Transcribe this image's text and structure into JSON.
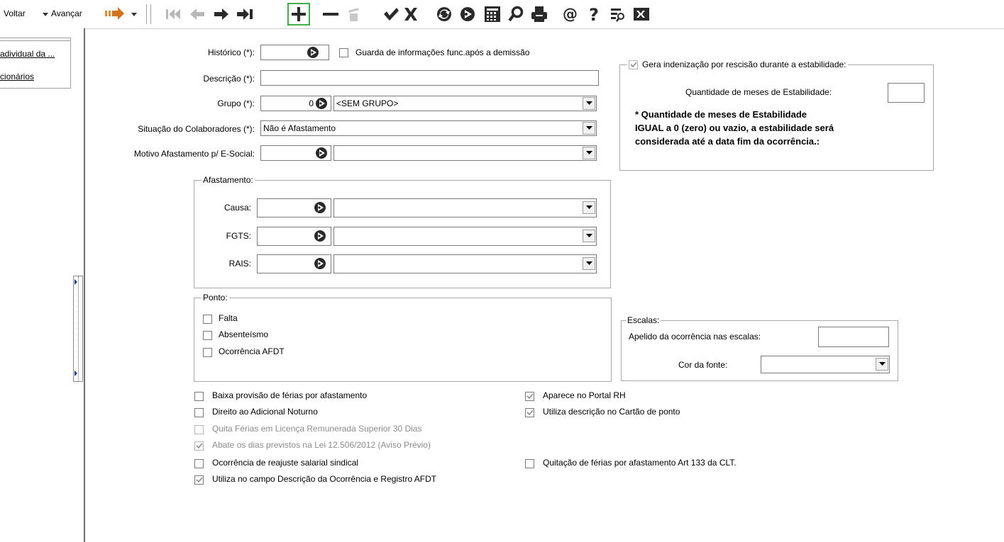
{
  "toolbar": {
    "back_label": "Voltar",
    "forward_label": "Avançar",
    "buttons": [
      "first-record-icon",
      "previous-record-icon",
      "next-record-icon",
      "last-record-icon",
      "add-icon",
      "remove-icon",
      "delete-icon",
      "confirm-icon",
      "cancel-icon",
      "refresh-icon",
      "execute-icon",
      "calculator-icon",
      "search-icon",
      "print-icon",
      "email-icon",
      "help-icon",
      "filter-icon",
      "excel-icon"
    ]
  },
  "sidebar": {
    "items": [
      "adividual da ...",
      "cionários"
    ]
  },
  "form": {
    "historico_label": "Histórico (*):",
    "historico_value": "",
    "guarda_label": "Guarda de informações func.após a demissão",
    "descricao_label": "Descrição (*):",
    "descricao_value": "",
    "grupo_label": "Grupo (*):",
    "grupo_code": "0",
    "grupo_value": "<SEM GRUPO>",
    "situacao_label": "Situação do Colaboradores (*):",
    "situacao_value": "Não é Afastamento",
    "motivo_label": "Motivo Afastamento p/ E-Social:",
    "motivo_code": "",
    "motivo_value": ""
  },
  "estabilidade": {
    "legend": "Gera indenização por rescisão durante a estabilidade:",
    "checked": true,
    "meses_label": "Quantidade de meses de Estabilidade:",
    "meses_value": "",
    "note_line1": "* Quantidade de meses de Estabilidade",
    "note_line2": "IGUAL a 0 (zero) ou vazio, a estabilidade será",
    "note_line3": "considerada até a data fim da ocorrência.:"
  },
  "afastamento": {
    "legend": "Afastamento:",
    "causa_label": "Causa:",
    "fgts_label": "FGTS:",
    "rais_label": "RAIS:"
  },
  "ponto": {
    "legend": "Ponto:",
    "items": [
      {
        "label": "Falta",
        "checked": false
      },
      {
        "label": "Absenteísmo",
        "checked": false
      },
      {
        "label": "Ocorrência AFDT",
        "checked": false
      }
    ]
  },
  "escalas": {
    "legend": "Escalas:",
    "apelido_label": "Apelido da ocorrência nas escalas:",
    "apelido_value": "",
    "cor_label": "Cor da fonte:",
    "cor_value": ""
  },
  "options_left": [
    {
      "label": "Baixa provisão de férias por afastamento",
      "checked": false,
      "disabled": false
    },
    {
      "label": "Direito ao Adicional Noturno",
      "checked": false,
      "disabled": false
    },
    {
      "label": "Quita Férias em Licença Remunerada Superior 30 Dias",
      "checked": false,
      "disabled": true
    },
    {
      "label": "Abate os dias previstos na Lei 12.506/2012 (Aviso Prévio)",
      "checked": true,
      "disabled": true
    },
    {
      "label": "Ocorrência de reajuste salarial sindical",
      "checked": false,
      "disabled": false
    },
    {
      "label": "Utiliza no campo Descrição da Ocorrência e Registro AFDT",
      "checked": true,
      "disabled": false
    }
  ],
  "options_right": [
    {
      "label": "Aparece no Portal RH",
      "checked": true,
      "disabled": false
    },
    {
      "label": "Utiliza descrição no Cartão de ponto",
      "checked": true,
      "disabled": false
    },
    {
      "label": "Quitação de férias por afastamento Art 133 da CLT.",
      "checked": false,
      "disabled": false
    }
  ]
}
